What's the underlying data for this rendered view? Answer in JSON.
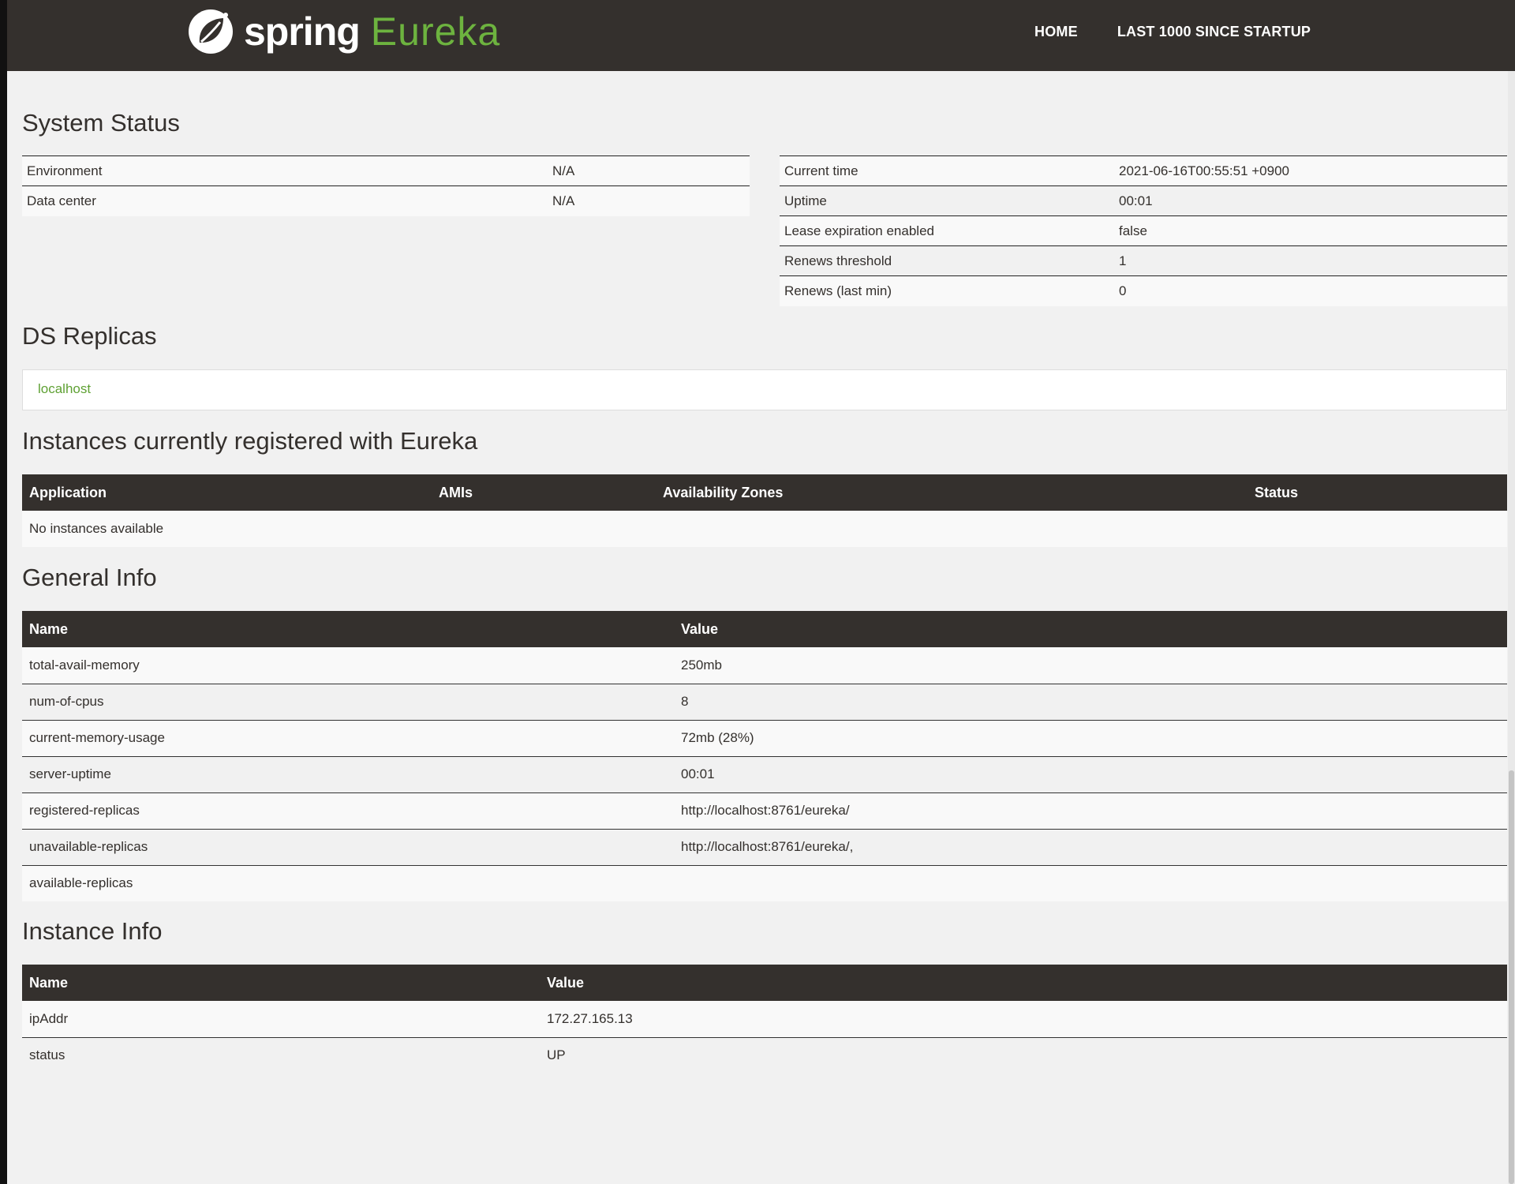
{
  "navbar": {
    "brand_spring": "spring",
    "brand_eureka": "Eureka",
    "links": [
      "HOME",
      "LAST 1000 SINCE STARTUP"
    ]
  },
  "system_status": {
    "title": "System Status",
    "left": [
      {
        "label": "Environment",
        "value": "N/A"
      },
      {
        "label": "Data center",
        "value": "N/A"
      }
    ],
    "right": [
      {
        "label": "Current time",
        "value": "2021-06-16T00:55:51 +0900"
      },
      {
        "label": "Uptime",
        "value": "00:01"
      },
      {
        "label": "Lease expiration enabled",
        "value": "false"
      },
      {
        "label": "Renews threshold",
        "value": "1"
      },
      {
        "label": "Renews (last min)",
        "value": "0"
      }
    ]
  },
  "ds_replicas": {
    "title": "DS Replicas",
    "items": [
      "localhost"
    ]
  },
  "instances": {
    "title": "Instances currently registered with Eureka",
    "columns": [
      "Application",
      "AMIs",
      "Availability Zones",
      "Status"
    ],
    "empty_text": "No instances available"
  },
  "general_info": {
    "title": "General Info",
    "columns": [
      "Name",
      "Value"
    ],
    "rows": [
      {
        "name": "total-avail-memory",
        "value": "250mb"
      },
      {
        "name": "num-of-cpus",
        "value": "8"
      },
      {
        "name": "current-memory-usage",
        "value": "72mb (28%)"
      },
      {
        "name": "server-uptime",
        "value": "00:01"
      },
      {
        "name": "registered-replicas",
        "value": "http://localhost:8761/eureka/"
      },
      {
        "name": "unavailable-replicas",
        "value": "http://localhost:8761/eureka/,"
      },
      {
        "name": "available-replicas",
        "value": ""
      }
    ]
  },
  "instance_info": {
    "title": "Instance Info",
    "columns": [
      "Name",
      "Value"
    ],
    "rows": [
      {
        "name": "ipAddr",
        "value": "172.27.165.13"
      },
      {
        "name": "status",
        "value": "UP"
      }
    ]
  },
  "colors": {
    "navbar": "#34302d",
    "brand_green": "#6db33f",
    "link_green": "#5fa134",
    "page_bg": "#f1f1f1"
  }
}
